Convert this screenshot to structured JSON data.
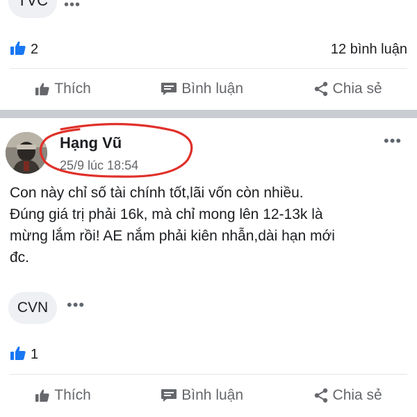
{
  "previous_post": {
    "tag": "TVC",
    "like_count": "2",
    "comment_count": "12 bình luận",
    "actions": {
      "like": "Thích",
      "comment": "Bình luận",
      "share": "Chia sẻ"
    }
  },
  "post": {
    "author": "Hạng Vũ",
    "timestamp": "25/9 lúc 18:54",
    "lines": [
      "Con này chỉ số tài chính tốt,lãi vốn còn nhiều.",
      "Đúng giá trị phải 16k, mà chỉ mong lên 12-13k là",
      "mừng lắm rồi! AE nắm phải kiên nhẫn,dài hạn mới",
      "đc."
    ],
    "tag": "CVN",
    "like_count": "1",
    "actions": {
      "like": "Thích",
      "comment": "Bình luận",
      "share": "Chia sẻ"
    }
  },
  "more_glyph": "•••",
  "colors": {
    "like_blue": "#1877f2",
    "secondary_text": "#65676b",
    "annotation_red": "#e0302a",
    "separator": "#c9ccd1"
  },
  "icons": [
    "thumbs-up-icon",
    "comment-icon",
    "share-icon",
    "more-icon"
  ]
}
